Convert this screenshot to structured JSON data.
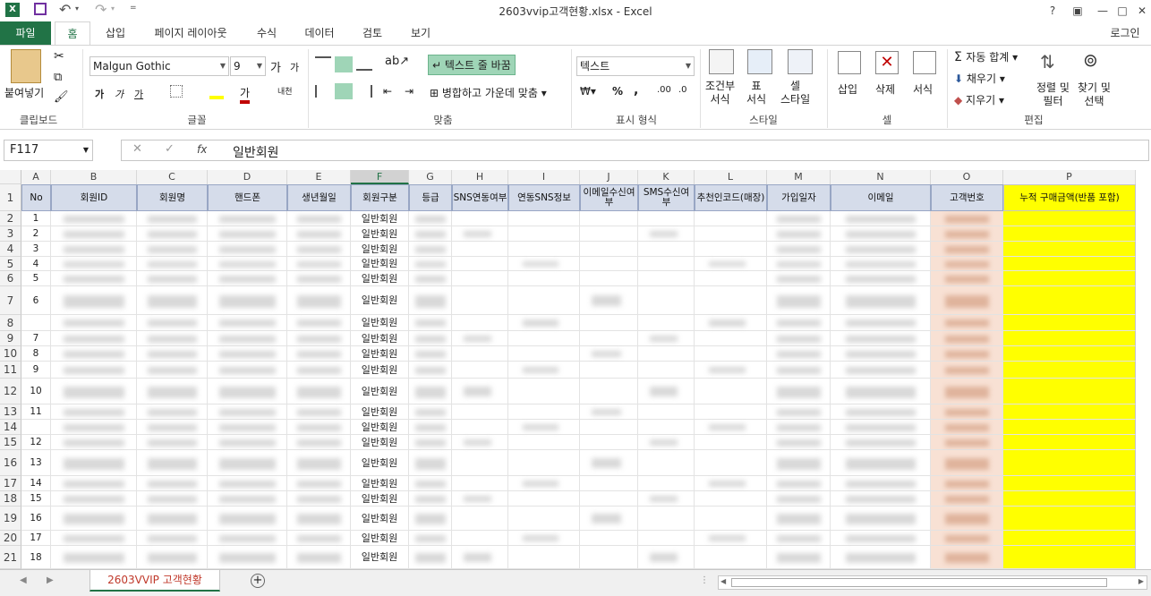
{
  "window": {
    "title": "2603vvip고객현황.xlsx - Excel",
    "help": "?",
    "restore": "▣",
    "minimize": "—",
    "maximize": "□",
    "close": "✕"
  },
  "tabs": [
    "파일",
    "홈",
    "삽입",
    "페이지 레이아웃",
    "수식",
    "데이터",
    "검토",
    "보기"
  ],
  "login": "로그인",
  "ribbon": {
    "clipboard": {
      "paste": "붙여넣기",
      "label": "클립보드"
    },
    "font": {
      "name": "Malgun Gothic",
      "size": "9",
      "bold": "가",
      "italic": "가",
      "underline": "가",
      "grow": "가",
      "shrink": "가",
      "color_a": "가",
      "phonetic": "내천",
      "label": "글꼴"
    },
    "align": {
      "wrap": "텍스트 줄 바꿈",
      "merge": "병합하고 가운데 맞춤",
      "label": "맞춤"
    },
    "number": {
      "format": "텍스트",
      "percent": "%",
      "comma": ",",
      "label": "표시 형식"
    },
    "styles": {
      "cond": "조건부\n서식",
      "table": "표\n서식",
      "cell": "셀\n스타일",
      "label": "스타일"
    },
    "cells": {
      "insert": "삽입",
      "delete": "삭제",
      "format": "서식",
      "label": "셀"
    },
    "edit": {
      "autosum": "자동 합계",
      "fill": "채우기",
      "clear": "지우기",
      "sort": "정렬 및\n필터",
      "find": "찾기 및\n선택",
      "label": "편집"
    }
  },
  "formula": {
    "namebox": "F117",
    "value": "일반회원",
    "fx": "fx",
    "cancel": "✕",
    "enter": "✓"
  },
  "columns": [
    "A",
    "B",
    "C",
    "D",
    "E",
    "F",
    "G",
    "H",
    "I",
    "J",
    "K",
    "L",
    "M",
    "N",
    "O",
    "P"
  ],
  "headers": [
    "No",
    "회원ID",
    "회원명",
    "핸드폰",
    "생년월일",
    "회원구분",
    "등급",
    "SNS연동여부",
    "연동SNS정보",
    "이메일수신여부",
    "SMS수신여부",
    "추천인코드(매장)",
    "가입일자",
    "이메일",
    "고객번호",
    "누적 구매금액(반품 포함)"
  ],
  "row_numbers": [
    "1",
    "2",
    "3",
    "4",
    "5",
    "6",
    "7",
    "8",
    "9",
    "10",
    "11",
    "12",
    "13",
    "14",
    "15",
    "16",
    "17",
    "18",
    "19",
    "20",
    "21"
  ],
  "no_values": [
    "1",
    "2",
    "3",
    "4",
    "5",
    "6",
    "",
    "7",
    "8",
    "9",
    "10",
    "11",
    "",
    "12",
    "13",
    "14",
    "15",
    "16",
    "17",
    "18",
    "19",
    "20"
  ],
  "member_type": "일반회원",
  "sheet_tab": "2603VVIP 고객현황",
  "colors": {
    "brand": "#217346",
    "header_fill": "#d5dcea",
    "highlight": "#ffff00",
    "customer_no": "#f8e1d4"
  }
}
